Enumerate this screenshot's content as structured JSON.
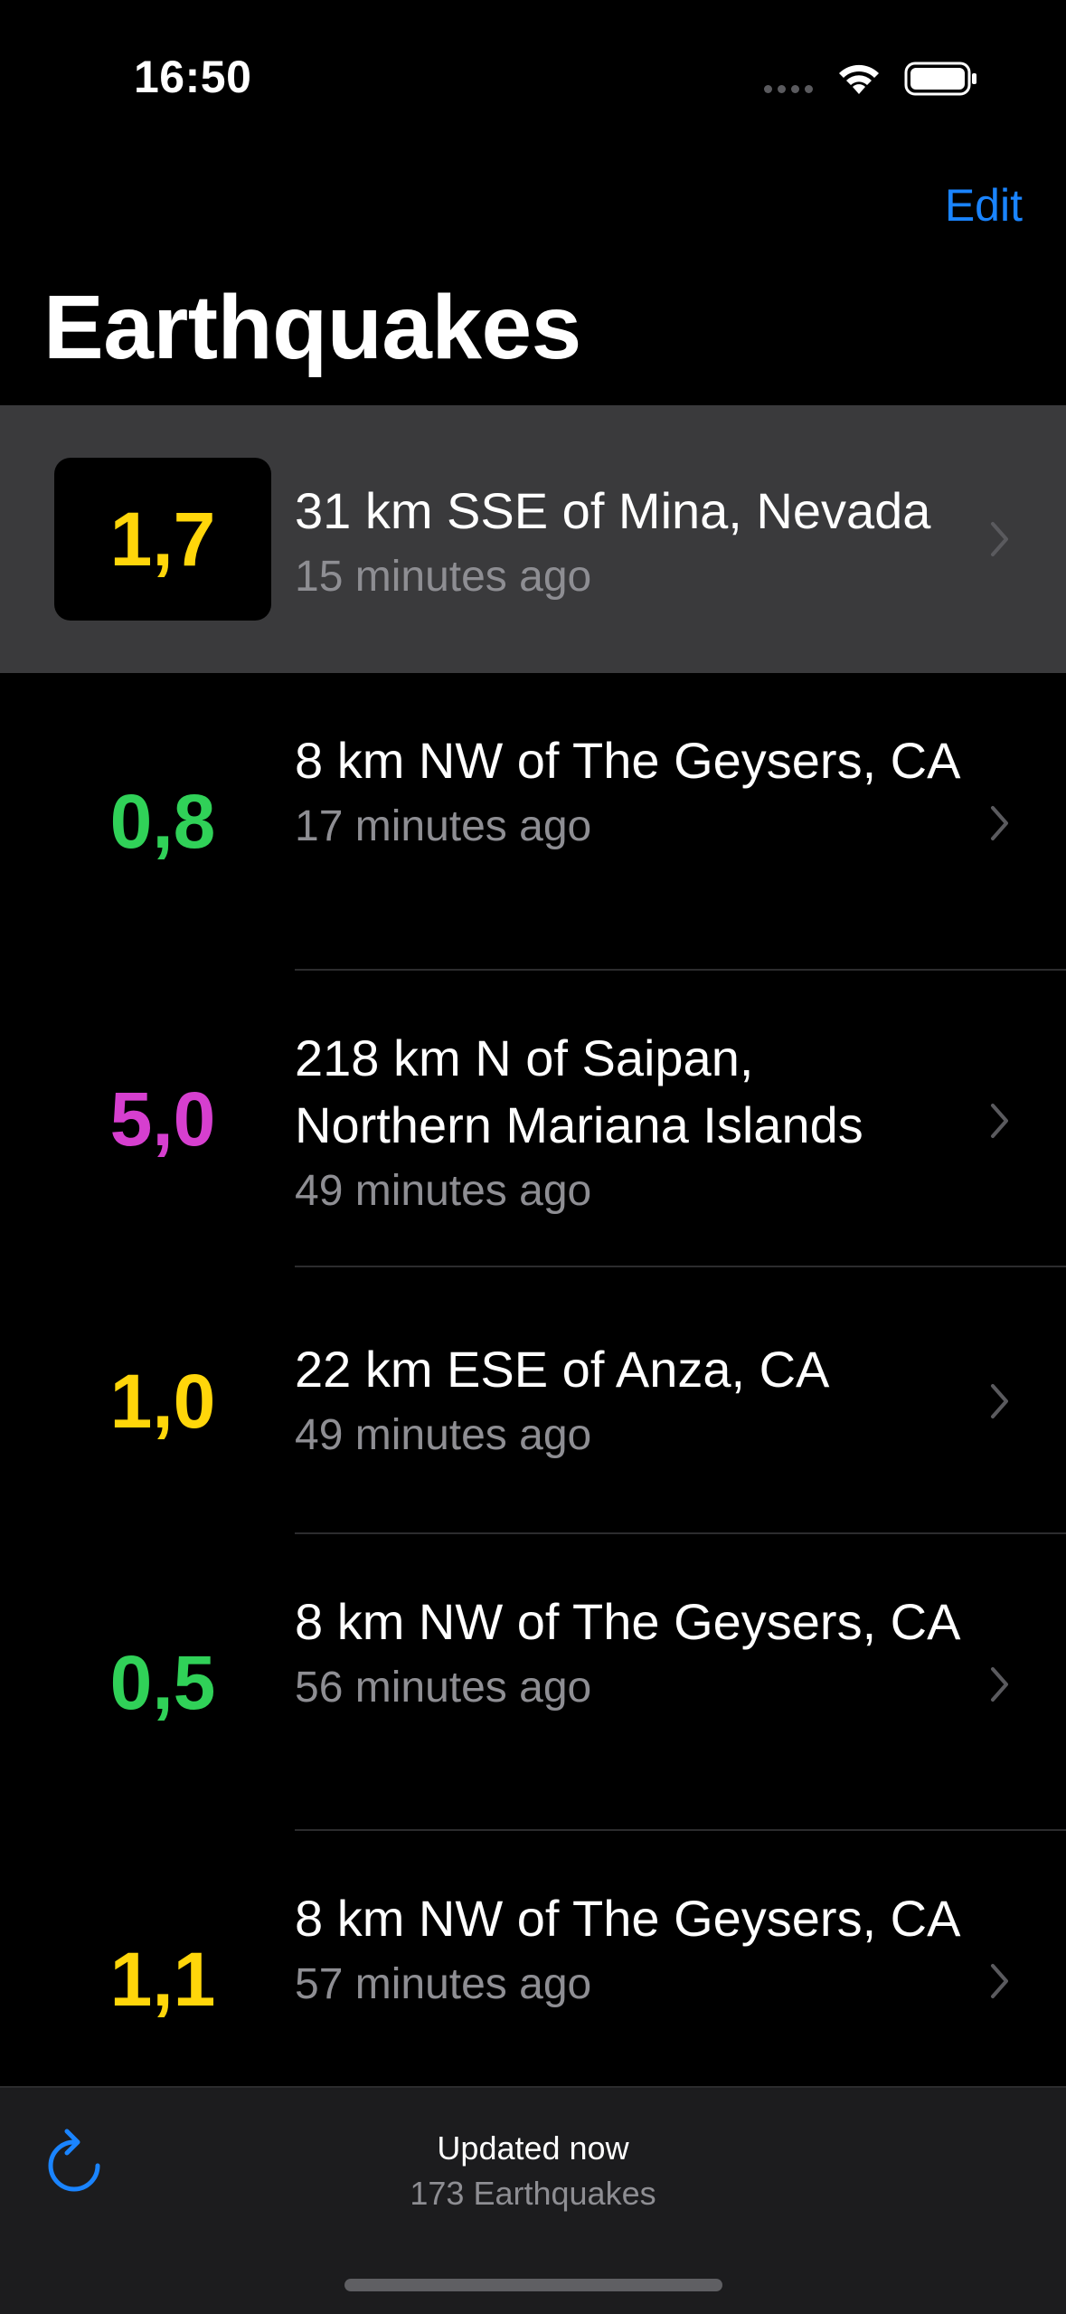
{
  "status_bar": {
    "time": "16:50"
  },
  "nav": {
    "edit_label": "Edit",
    "title": "Earthquakes"
  },
  "quakes": [
    {
      "magnitude": "1,7",
      "place": "31 km SSE of Mina, Nevada",
      "time": "15 minutes ago",
      "color": "#ffd60a",
      "selected": true
    },
    {
      "magnitude": "0,8",
      "place": "8 km NW of The Geysers, CA",
      "time": "17 minutes ago",
      "color": "#30d158",
      "selected": false
    },
    {
      "magnitude": "5,0",
      "place": "218 km N of Saipan, Northern Mariana Islands",
      "time": "49 minutes ago",
      "color": "#d63fcf",
      "selected": false
    },
    {
      "magnitude": "1,0",
      "place": "22 km ESE of Anza, CA",
      "time": "49 minutes ago",
      "color": "#ffd60a",
      "selected": false
    },
    {
      "magnitude": "0,5",
      "place": "8 km NW of The Geysers, CA",
      "time": "56 minutes ago",
      "color": "#30d158",
      "selected": false
    },
    {
      "magnitude": "1,1",
      "place": "8 km NW of The Geysers, CA",
      "time": "57 minutes ago",
      "color": "#ffd60a",
      "selected": false
    }
  ],
  "toolbar": {
    "updated": "Updated now",
    "count": "173 Earthquakes",
    "refresh_icon": "refresh-icon"
  },
  "colors": {
    "accent": "#1a84ff",
    "selected_row": "#3a3a3c",
    "secondary_text": "#8e8e93"
  }
}
